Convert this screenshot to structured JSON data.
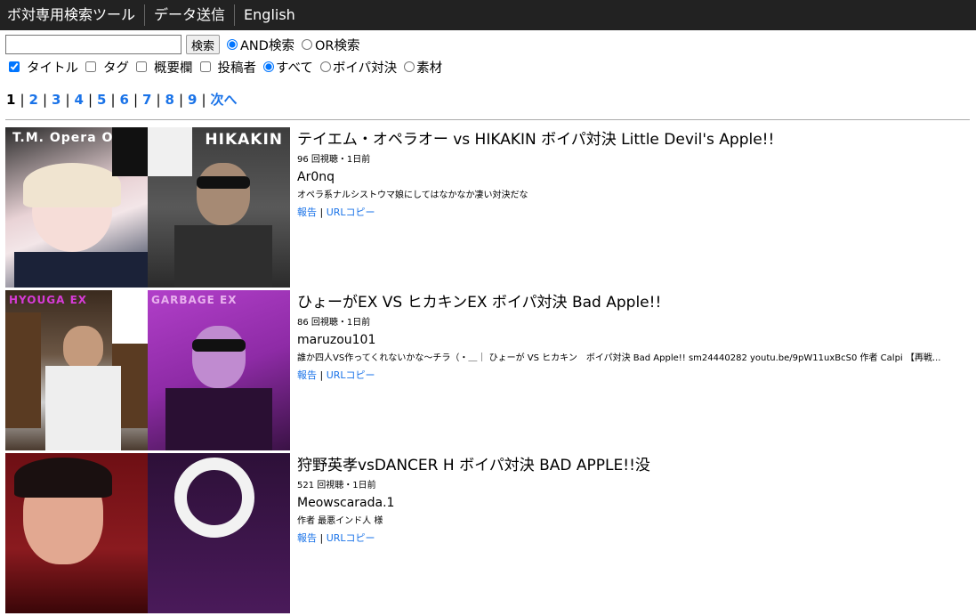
{
  "nav": {
    "items": [
      "ボ対専用検索ツール",
      "データ送信",
      "English"
    ]
  },
  "search": {
    "value": "",
    "placeholder": "",
    "button_label": "検索",
    "mode_and": "AND検索",
    "mode_or": "OR検索"
  },
  "filters": {
    "title": "タイトル",
    "tag": "タグ",
    "description": "概要欄",
    "poster": "投稿者",
    "all": "すべて",
    "voipa": "ボイパ対決",
    "material": "素材"
  },
  "pagination": {
    "current": "1",
    "pages": [
      "2",
      "3",
      "4",
      "5",
      "6",
      "7",
      "8",
      "9"
    ],
    "next": "次へ"
  },
  "results": [
    {
      "title": "テイエム・オペラオー vs HIKAKIN ボイパ対決 Little Devil's Apple!!",
      "meta": "96 回視聴・1日前",
      "uploader": "Ar0nq",
      "desc": "オペラ系ナルシストウマ娘にしてはなかなか凄い対決だな",
      "report": "報告",
      "copy": "URLコピー",
      "thumb_left": "T.M. Opera O",
      "thumb_right": "HIKAKIN"
    },
    {
      "title": "ひょーがEX VS ヒカキンEX ボイパ対決 Bad Apple!!",
      "meta": "86 回視聴・1日前",
      "uploader": "maruzou101",
      "desc": "誰か四人VS作ってくれないかな〜チラ（・＿｜ ひょーが VS ヒカキン　ボイパ対決 Bad Apple!! sm24440282 youtu.be/9pW11uxBcS0 作者 Calpi 【再戦...",
      "report": "報告",
      "copy": "URLコピー",
      "thumb_left": "HYOUGA EX",
      "thumb_right": "GARBAGE EX"
    },
    {
      "title": "狩野英孝vsDANCER H ボイパ対決 BAD APPLE!!没",
      "meta": "521 回視聴・1日前",
      "uploader": "Meowscarada.1",
      "desc": "作者 最悪インド人 様",
      "report": "報告",
      "copy": "URLコピー",
      "thumb_left": "",
      "thumb_right": ""
    }
  ],
  "colors": {
    "nav_bg": "#222222",
    "link": "#1a73e8"
  }
}
